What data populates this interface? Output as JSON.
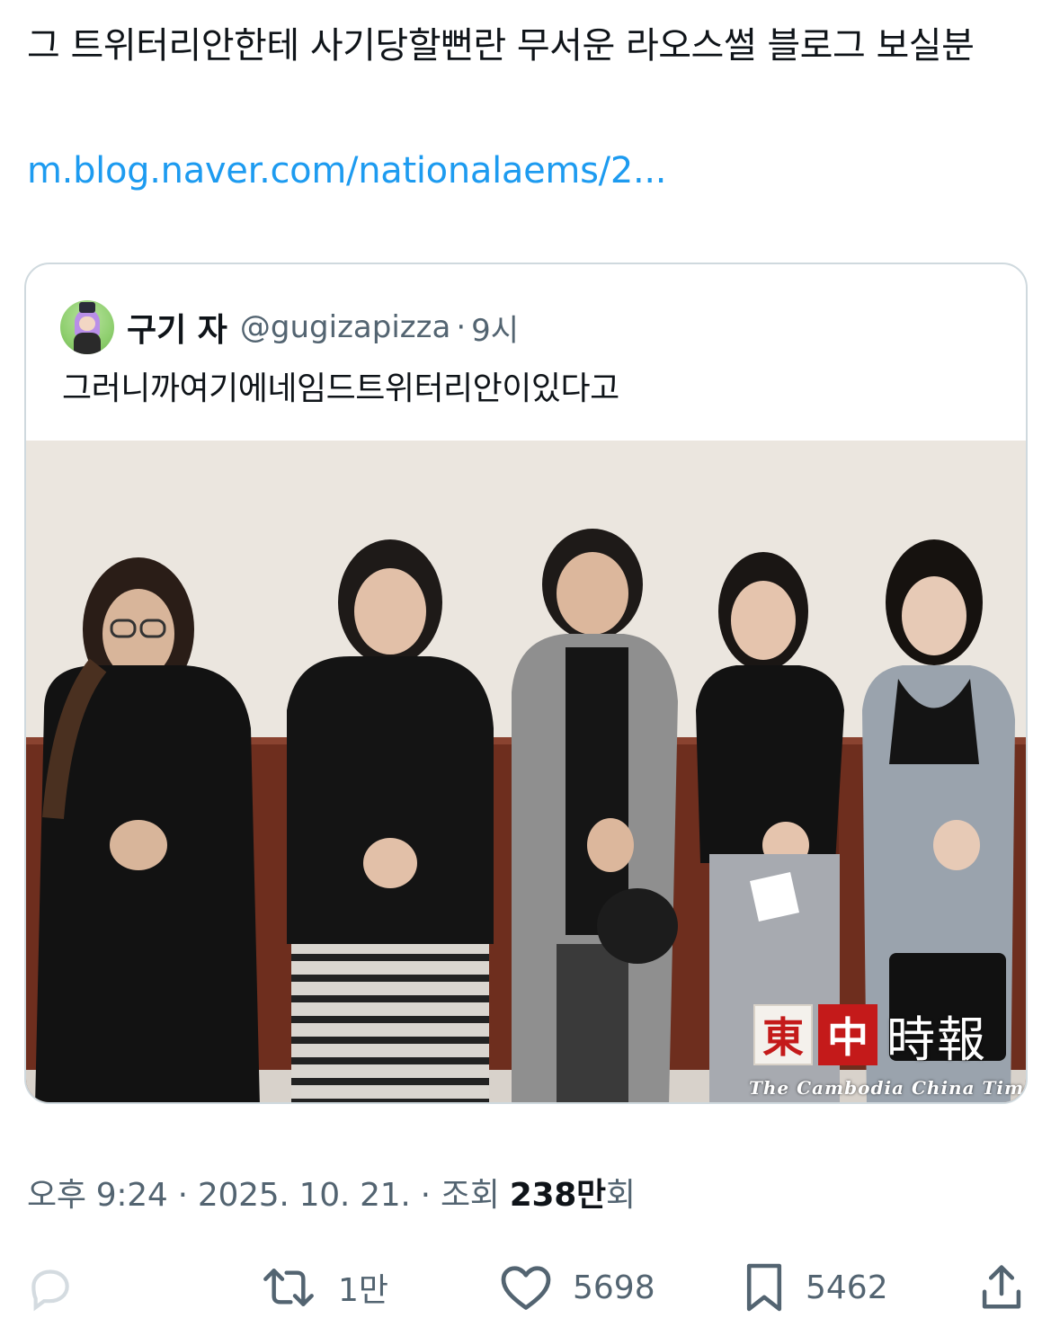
{
  "tweet": {
    "text": "그 트위터리안한테 사기당할뻔란 무서운 라오스썰 블로그 보실분",
    "link": "m.blog.naver.com/nationalaems/2..."
  },
  "quote": {
    "name": "구기 자",
    "handle": "@gugizapizza",
    "dot": "·",
    "time": "9시",
    "text": "그러니까여기에네임드트위터리안이있다고",
    "photo_watermark": {
      "chars": [
        "東",
        "中",
        "時報"
      ],
      "subtitle": "The Cambodia China Times"
    }
  },
  "meta": {
    "time": "오후 9:24",
    "sep1": "·",
    "date": "2025. 10. 21.",
    "sep2": "·",
    "views_label": "조회",
    "views_number": "238만",
    "views_suffix": "회"
  },
  "actions": {
    "reply_icon": "reply-icon",
    "retweet_icon": "retweet-icon",
    "retweet_count": "1만",
    "like_icon": "heart-icon",
    "like_count": "5698",
    "bookmark_icon": "bookmark-icon",
    "bookmark_count": "5462",
    "share_icon": "share-icon"
  },
  "colors": {
    "link": "#1d9bf0",
    "secondary": "#536471",
    "text": "#0f1419",
    "border": "#cfd9de"
  }
}
